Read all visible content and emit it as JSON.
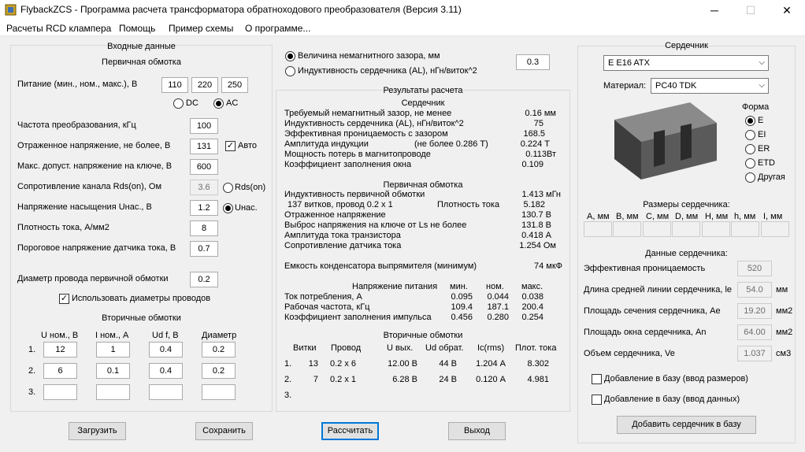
{
  "window": {
    "title": "FlybackZCS - Программа расчета трансформатора обратноходового преобразователя (Версия 3.11)",
    "minimize": "─",
    "maximize": "☐",
    "close": "✕"
  },
  "menu": [
    "Расчеты RCD клампера",
    "Помощь",
    "Пример схемы",
    "О программе..."
  ],
  "input": {
    "header": "Входные данные",
    "primary_header": "Первичная обмотка",
    "supply_label": "Питание (мин., ном., макс.), В",
    "supply_values": [
      "110",
      "220",
      "250"
    ],
    "dc_label": "DC",
    "ac_label": "AC",
    "freq_label": "Частота преобразования, кГц",
    "freq_value": "100",
    "reflected_label": "Отраженное напряжение, не более, В",
    "reflected_value": "131",
    "auto_label": "Авто",
    "vmax_label": "Макс. допуст. напряжение на ключе, В",
    "vmax_value": "600",
    "rds_label": "Сопротивление канала Rds(on), Ом",
    "rds_value": "3.6",
    "rds_radio": "Rds(on)",
    "usat_label": "Напряжение насыщения Uнас., В",
    "usat_value": "1.2",
    "usat_radio": "Uнас.",
    "jdens_label": "Плотность тока, А/мм2",
    "jdens_value": "8",
    "vsense_label": "Пороговое напряжение датчика тока, В",
    "vsense_value": "0.7",
    "wire_label": "Диаметр провода первичной обмотки",
    "wire_value": "0.2",
    "use_diam_label": "Использовать диаметры проводов",
    "secondary_header": "Вторичные обмотки",
    "sec_cols": [
      "U ном., В",
      "I ном., А",
      "Ud f, В",
      "Диаметр"
    ],
    "sec_rows": [
      {
        "n": "1.",
        "vals": [
          "12",
          "1",
          "0.4",
          "0.2"
        ]
      },
      {
        "n": "2.",
        "vals": [
          "6",
          "0.1",
          "0.4",
          "0.2"
        ]
      },
      {
        "n": "3.",
        "vals": [
          "",
          "",
          "",
          ""
        ]
      }
    ]
  },
  "gap": {
    "gap_label": "Величина немагнитного зазора, мм",
    "al_label": "Индуктивность сердечника (AL), нГн/виток^2",
    "value": "0.3"
  },
  "results": {
    "header": "Результаты расчета",
    "core_header": "Сердечник",
    "core": [
      {
        "l": "Требуемый немагнитный зазор, не менее",
        "v": "0.16 мм"
      },
      {
        "l": "Индуктивность сердечника (AL), нГн/виток^2",
        "v": "75"
      },
      {
        "l": "Эффективная проницаемость с зазором",
        "v": "168.5"
      },
      {
        "l": "Амплитуда индукции",
        "m": "(не более 0.286 Т)",
        "v": "0.224 Т"
      },
      {
        "l": "Мощность потерь в магнитопроводе",
        "v": "0.113Вт"
      },
      {
        "l": "Коэффициент заполнения окна",
        "v": "0.109"
      }
    ],
    "primary_header": "Первичная обмотка",
    "primary": [
      {
        "l": "Индуктивность первичной обмотки",
        "v": "1.413 мГн"
      },
      {
        "l": "137 витков, провод 0.2 x 1",
        "m": "Плотность тока",
        "v": "5.182"
      },
      {
        "l": "Отраженное напряжение",
        "v": "130.7 В"
      },
      {
        "l": "Выброс напряжения на ключе от Ls не более",
        "v": "131.8 В"
      },
      {
        "l": "Амплитуда тока транзистора",
        "v": "0.418 А"
      },
      {
        "l": "Сопротивление датчика тока",
        "v": "1.254 Ом"
      }
    ],
    "cap_label": "Емкость конденсатора выпрямителя (минимум)",
    "cap_value": "74 мкФ",
    "supply_header": "Напряжение питания",
    "supply_cols": [
      "мин.",
      "ном.",
      "макс."
    ],
    "supply_rows": [
      {
        "l": "Ток потребления, А",
        "v": [
          "0.095",
          "0.044",
          "0.038"
        ]
      },
      {
        "l": "Рабочая частота, кГц",
        "v": [
          "109.4",
          "187.1",
          "200.4"
        ]
      },
      {
        "l": "Коэффициент заполнения импульса",
        "v": [
          "0.456",
          "0.280",
          "0.254"
        ]
      }
    ],
    "sec_header": "Вторичные обмотки",
    "sec_cols": [
      "Витки",
      "Провод",
      "U вых.",
      "Ud обрат.",
      "Ic(rms)",
      "Плот. тока"
    ],
    "sec_rows": [
      {
        "n": "1.",
        "v": [
          "13",
          "0.2 x 6",
          "12.00 В",
          "44 В",
          "1.204 А",
          "8.302"
        ]
      },
      {
        "n": "2.",
        "v": [
          "7",
          "0.2 x 1",
          "6.28 В",
          "24 В",
          "0.120 А",
          "4.981"
        ]
      },
      {
        "n": "3.",
        "v": [
          "",
          "",
          "",
          "",
          "",
          ""
        ]
      }
    ]
  },
  "core": {
    "header": "Сердечник",
    "core_select": "E E16 ATX",
    "material_label": "Материал:",
    "material_select": "PC40 TDK",
    "shape_header": "Форма",
    "shapes": [
      "E",
      "EI",
      "ER",
      "ETD",
      "Другая"
    ],
    "dims_header": "Размеры сердечника:",
    "dims_cols": [
      "A, мм",
      "B, мм",
      "C, мм",
      "D, мм",
      "H, мм",
      "h, мм",
      "I, мм"
    ],
    "data_header": "Данные сердечника:",
    "data": [
      {
        "l": "Эффективная проницаемость",
        "v": "520",
        "u": ""
      },
      {
        "l": "Длина средней линии сердечника, le",
        "v": "54.0",
        "u": "мм"
      },
      {
        "l": "Площадь сечения сердечника, Ae",
        "v": "19.20",
        "u": "мм2"
      },
      {
        "l": "Площадь окна сердечника, An",
        "v": "64.00",
        "u": "мм2"
      },
      {
        "l": "Объем сердечника, Ve",
        "v": "1.037",
        "u": "см3"
      }
    ],
    "add_dims_label": "Добавление в базу (ввод размеров)",
    "add_data_label": "Добавление в базу (ввод данных)",
    "add_button": "Добавить сердечник в базу"
  },
  "buttons": {
    "load": "Загрузить",
    "save": "Сохранить",
    "calc": "Рассчитать",
    "exit": "Выход"
  }
}
